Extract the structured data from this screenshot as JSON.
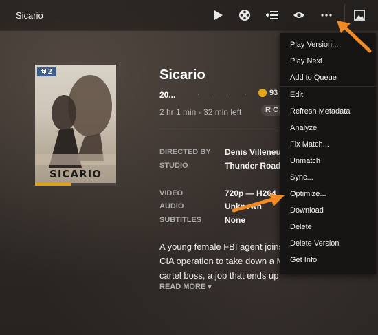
{
  "app": {
    "title": "Sicario"
  },
  "toolbar": {
    "icons": [
      "play-icon",
      "trailer-reel-icon",
      "add-to-queue-icon",
      "eye-icon",
      "more-icon",
      "image-icon"
    ]
  },
  "poster": {
    "badge_count": "2",
    "logo_text": "SICARIO",
    "progress_fraction": 0.45
  },
  "movie": {
    "title": "Sicario",
    "year": "20...",
    "dots": "· · · · ·",
    "score": "93",
    "runtime": "2 hr 1 min  ·  32 min left",
    "rating_chip": "R C"
  },
  "meta": [
    {
      "label": "DIRECTED BY",
      "value": "Denis Villeneu"
    },
    {
      "label": "STUDIO",
      "value": "Thunder Road"
    },
    {
      "label": "VIDEO",
      "value": "720p — H264"
    },
    {
      "label": "AUDIO",
      "value": "Unknown"
    },
    {
      "label": "SUBTITLES",
      "value": "None"
    }
  ],
  "summary": {
    "lines": [
      "A young female FBI agent joins",
      "CIA operation to take down a M",
      "cartel boss, a job that ends up"
    ],
    "read_more": "READ MORE ▾"
  },
  "menu": {
    "group1": [
      "Play Version...",
      "Play Next",
      "Add to Queue"
    ],
    "group2": [
      "Edit",
      "Refresh Metadata",
      "Analyze",
      "Fix Match...",
      "Unmatch",
      "Sync...",
      "Optimize...",
      "Download",
      "Delete",
      "Delete Version",
      "Get Info"
    ]
  },
  "colors": {
    "accent": "#e5a00d",
    "arrow": "#f08a24",
    "badge": "#3e5d8a",
    "menu_bg": "#161514"
  }
}
